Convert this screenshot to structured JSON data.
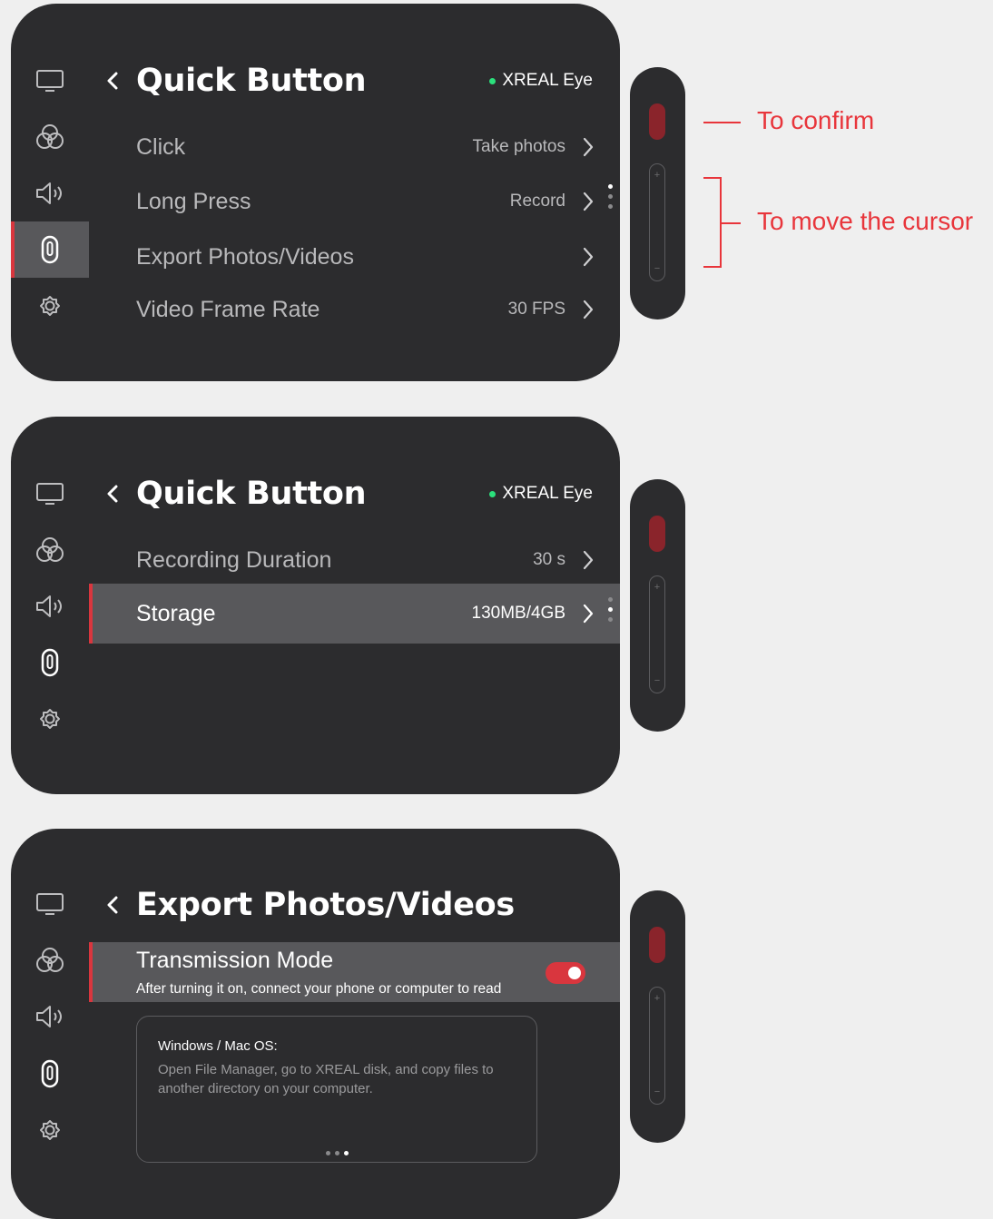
{
  "panels": [
    {
      "title": "Quick Button",
      "device": "XREAL Eye",
      "rows": [
        {
          "label": "Click",
          "value": "Take photos"
        },
        {
          "label": "Long Press",
          "value": "Record"
        },
        {
          "label": "Export Photos/Videos",
          "value": ""
        },
        {
          "label": "Video Frame Rate",
          "value": "30 FPS"
        }
      ]
    },
    {
      "title": "Quick Button",
      "device": "XREAL Eye",
      "rows": [
        {
          "label": "Recording Duration",
          "value": "30 s"
        },
        {
          "label": "Storage",
          "value": "130MB/4GB"
        }
      ]
    },
    {
      "title": "Export Photos/Videos",
      "toggle": {
        "label": "Transmission Mode",
        "description": "After turning it on, connect your phone or computer to read",
        "state": "on"
      },
      "info_card": {
        "heading": "Windows / Mac OS:",
        "body": "Open File Manager, go to XREAL disk, and copy files to another directory on your computer."
      }
    }
  ],
  "sidebar_icons": [
    "display-icon",
    "color-icon",
    "volume-icon",
    "quick-button-icon",
    "settings-icon"
  ],
  "controller": {
    "plus": "+",
    "minus": "−"
  },
  "annotations": {
    "confirm": "To confirm",
    "move": "To move the cursor"
  },
  "colors": {
    "accent": "#d9363e",
    "panel": "#2c2c2e",
    "highlight": "#58585b",
    "status_dot": "#2be07c",
    "annotation": "#e8353b"
  }
}
